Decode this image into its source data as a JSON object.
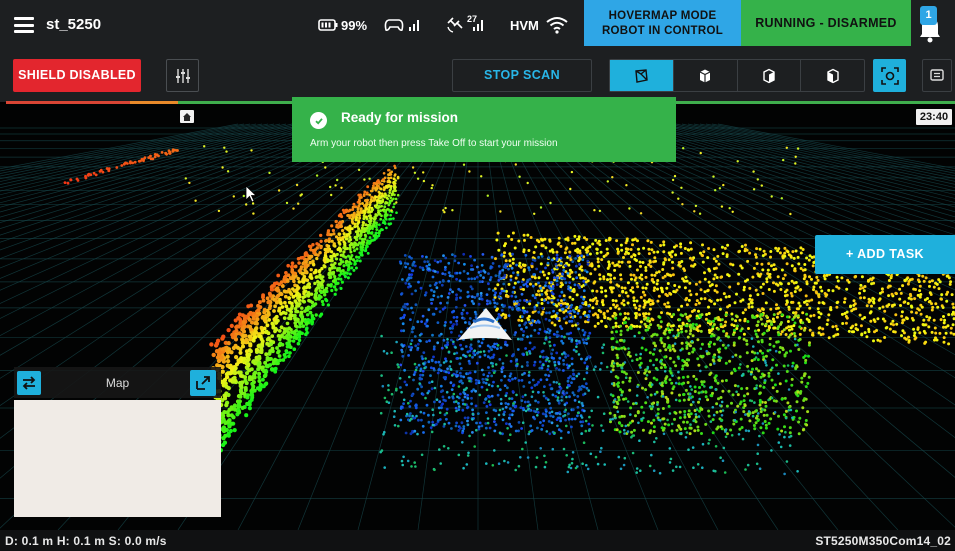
{
  "header": {
    "device_name": "st_5250",
    "battery_percent": "99%",
    "satellite_count": "27",
    "hvm_label": "HVM",
    "mode_line1": "HOVERMAP MODE",
    "mode_line2": "ROBOT IN CONTROL",
    "status": "RUNNING - DISARMED",
    "notification_count": "1"
  },
  "toolbar": {
    "shield_label": "SHIELD DISABLED",
    "stop_scan_label": "STOP SCAN"
  },
  "viewport": {
    "clock": "23:40",
    "add_task_label": "+ ADD TASK"
  },
  "toast": {
    "title": "Ready for mission",
    "message": "Arm your robot then press Take Off to start your mission"
  },
  "minimap": {
    "title": "Map"
  },
  "footer": {
    "telemetry": "D: 0.1 m  H: 0.1 m  S: 0.0 m/s",
    "serial": "ST5250M350Com14_02"
  },
  "colors": {
    "accent": "#1fb0dc",
    "mode_blue": "#2fa6e6",
    "status_green": "#35b24a",
    "shield_red": "#e3262e"
  }
}
